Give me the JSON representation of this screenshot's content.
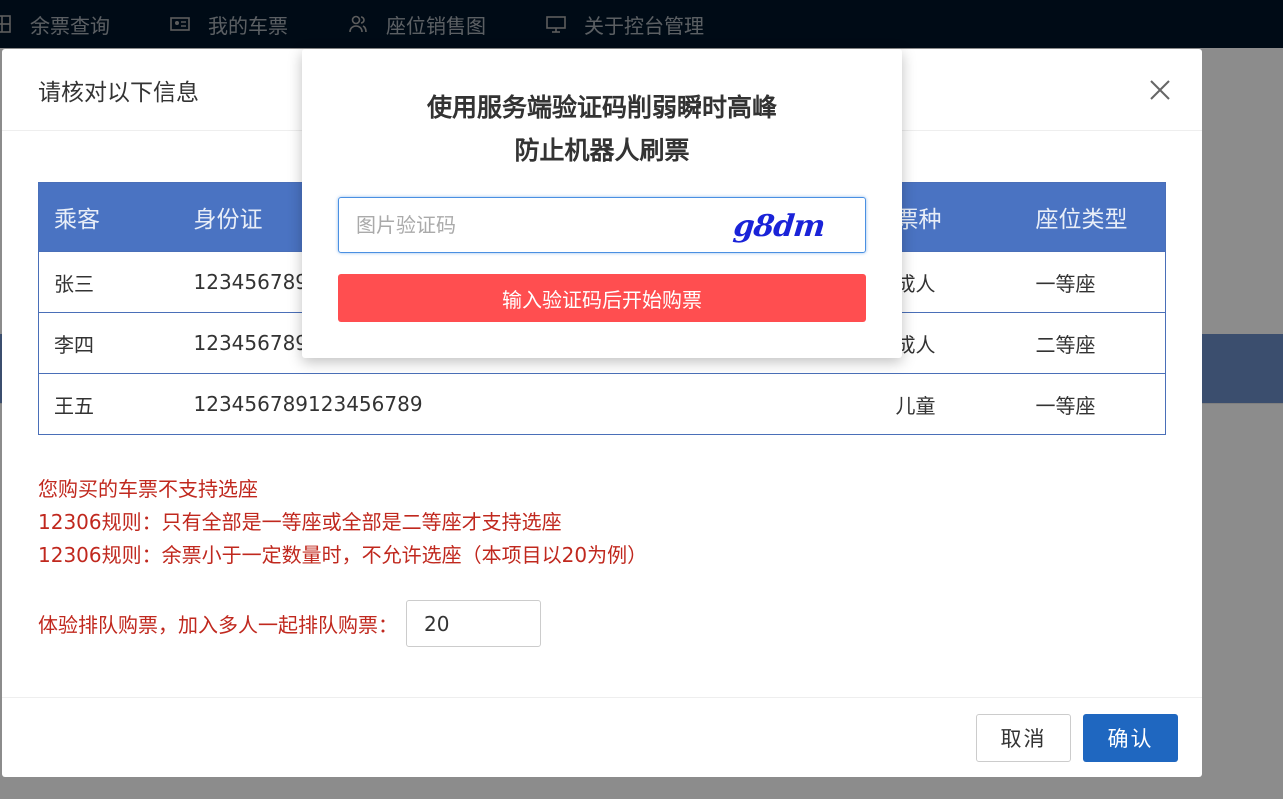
{
  "nav": {
    "items": [
      {
        "label": "余票查询",
        "icon": "grid-icon"
      },
      {
        "label": "我的车票",
        "icon": "id-card-icon"
      },
      {
        "label": "座位销售图",
        "icon": "users-icon"
      },
      {
        "label": "关于控台管理",
        "icon": "monitor-icon"
      }
    ]
  },
  "confirm": {
    "title": "请核对以下信息",
    "columns": [
      "乘客",
      "身份证",
      "票种",
      "座位类型"
    ],
    "rows": [
      {
        "name": "张三",
        "id": "123456789",
        "type": "成人",
        "seat": "一等座"
      },
      {
        "name": "李四",
        "id": "123456789",
        "type": "成人",
        "seat": "二等座"
      },
      {
        "name": "王五",
        "id": "123456789123456789",
        "type": "儿童",
        "seat": "一等座"
      }
    ],
    "tips": [
      "您购买的车票不支持选座",
      "12306规则：只有全部是一等座或全部是二等座才支持选座",
      "12306规则：余票小于一定数量时，不允许选座（本项目以20为例）"
    ],
    "queue_label": "体验排队购票，加入多人一起排队购票：",
    "queue_value": "20",
    "cancel_label": "取消",
    "ok_label": "确认"
  },
  "captcha": {
    "title_line1": "使用服务端验证码削弱瞬时高峰",
    "title_line2": "防止机器人刷票",
    "placeholder": "图片验证码",
    "image_text": "g8dm",
    "submit_label": "输入验证码后开始购票"
  },
  "colors": {
    "nav_bg": "#001529",
    "table_header": "#4a73c2",
    "tip_red": "#c0281e",
    "ok_blue": "#1f67c0",
    "captcha_button": "#ff4e50",
    "captcha_text": "#1a23d8"
  }
}
